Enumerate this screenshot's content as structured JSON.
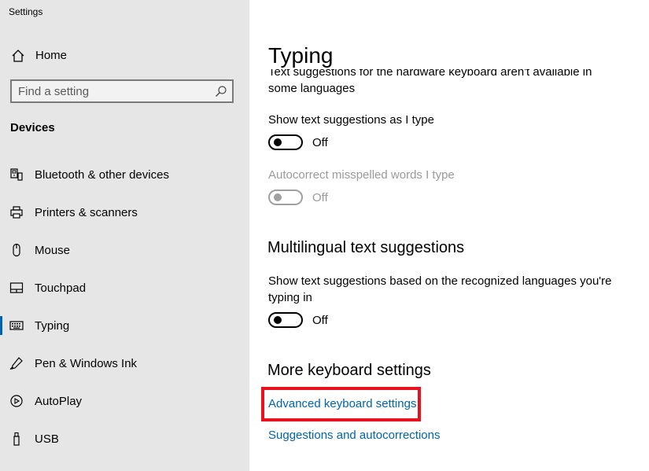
{
  "app": {
    "title": "Settings"
  },
  "sidebar": {
    "home_label": "Home",
    "search": {
      "placeholder": "Find a setting",
      "value": ""
    },
    "section": "Devices",
    "items": [
      {
        "label": "Bluetooth & other devices",
        "icon": "bluetooth-devices-icon"
      },
      {
        "label": "Printers & scanners",
        "icon": "printer-icon"
      },
      {
        "label": "Mouse",
        "icon": "mouse-icon"
      },
      {
        "label": "Touchpad",
        "icon": "touchpad-icon"
      },
      {
        "label": "Typing",
        "icon": "keyboard-icon",
        "selected": true
      },
      {
        "label": "Pen & Windows Ink",
        "icon": "pen-icon"
      },
      {
        "label": "AutoPlay",
        "icon": "autoplay-icon"
      },
      {
        "label": "USB",
        "icon": "usb-icon"
      }
    ]
  },
  "main": {
    "title": "Typing",
    "cut_text_line1": "Text suggestions for the hardware keyboard aren't available in",
    "cut_text_line2": "some languages",
    "show_suggestions": {
      "label": "Show text suggestions as I type",
      "state": "Off"
    },
    "autocorrect": {
      "label": "Autocorrect misspelled words I type",
      "state": "Off",
      "disabled": true
    },
    "multilingual": {
      "heading": "Multilingual text suggestions",
      "desc_line1": "Show text suggestions based on the recognized languages you're",
      "desc_line2": "typing in",
      "state": "Off"
    },
    "more": {
      "heading": "More keyboard settings",
      "link1": "Advanced keyboard settings",
      "link2": "Suggestions and autocorrections"
    }
  },
  "colors": {
    "accent": "#0063b1",
    "highlight": "#e8111d",
    "sidebar_bg": "#e6e6e6"
  }
}
